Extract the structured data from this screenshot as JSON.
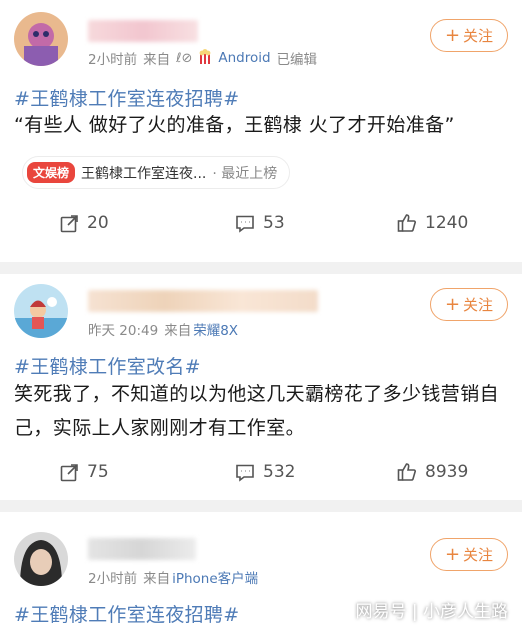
{
  "posts": [
    {
      "time": "2小时前",
      "from_label": "来自",
      "device": "Android",
      "edited": "已编辑",
      "follow_label": "关注",
      "hashtag": "#王鹤棣工作室连夜招聘#",
      "body": "“有些人 做好了火的准备，王鹤棣 火了才开始准备”",
      "card": {
        "badge": "文娱榜",
        "title": "王鹤棣工作室连夜...",
        "sub": "· 最近上榜"
      },
      "reposts": "20",
      "comments": "53",
      "likes": "1240"
    },
    {
      "time": "昨天 20:49",
      "from_label": "来自",
      "device": "荣耀8X",
      "follow_label": "关注",
      "hashtag": "#王鹤棣工作室改名#",
      "body": "笑死我了，不知道的以为他这几天霸榜花了多少钱营销自己，实际上人家刚刚才有工作室。",
      "reposts": "75",
      "comments": "532",
      "likes": "8939"
    },
    {
      "time": "2小时前",
      "from_label": "来自",
      "device": "iPhone客户端",
      "follow_label": "关注",
      "hashtag": "#王鹤棣工作室连夜招聘#"
    }
  ],
  "watermark": "网易号 | 小彦人生路",
  "colors": {
    "link": "#4f7cb7",
    "follow": "#e8853f",
    "badge": "#e9463d"
  },
  "icons": {
    "repost": "repost-icon",
    "comment": "comment-icon",
    "like": "like-icon"
  }
}
